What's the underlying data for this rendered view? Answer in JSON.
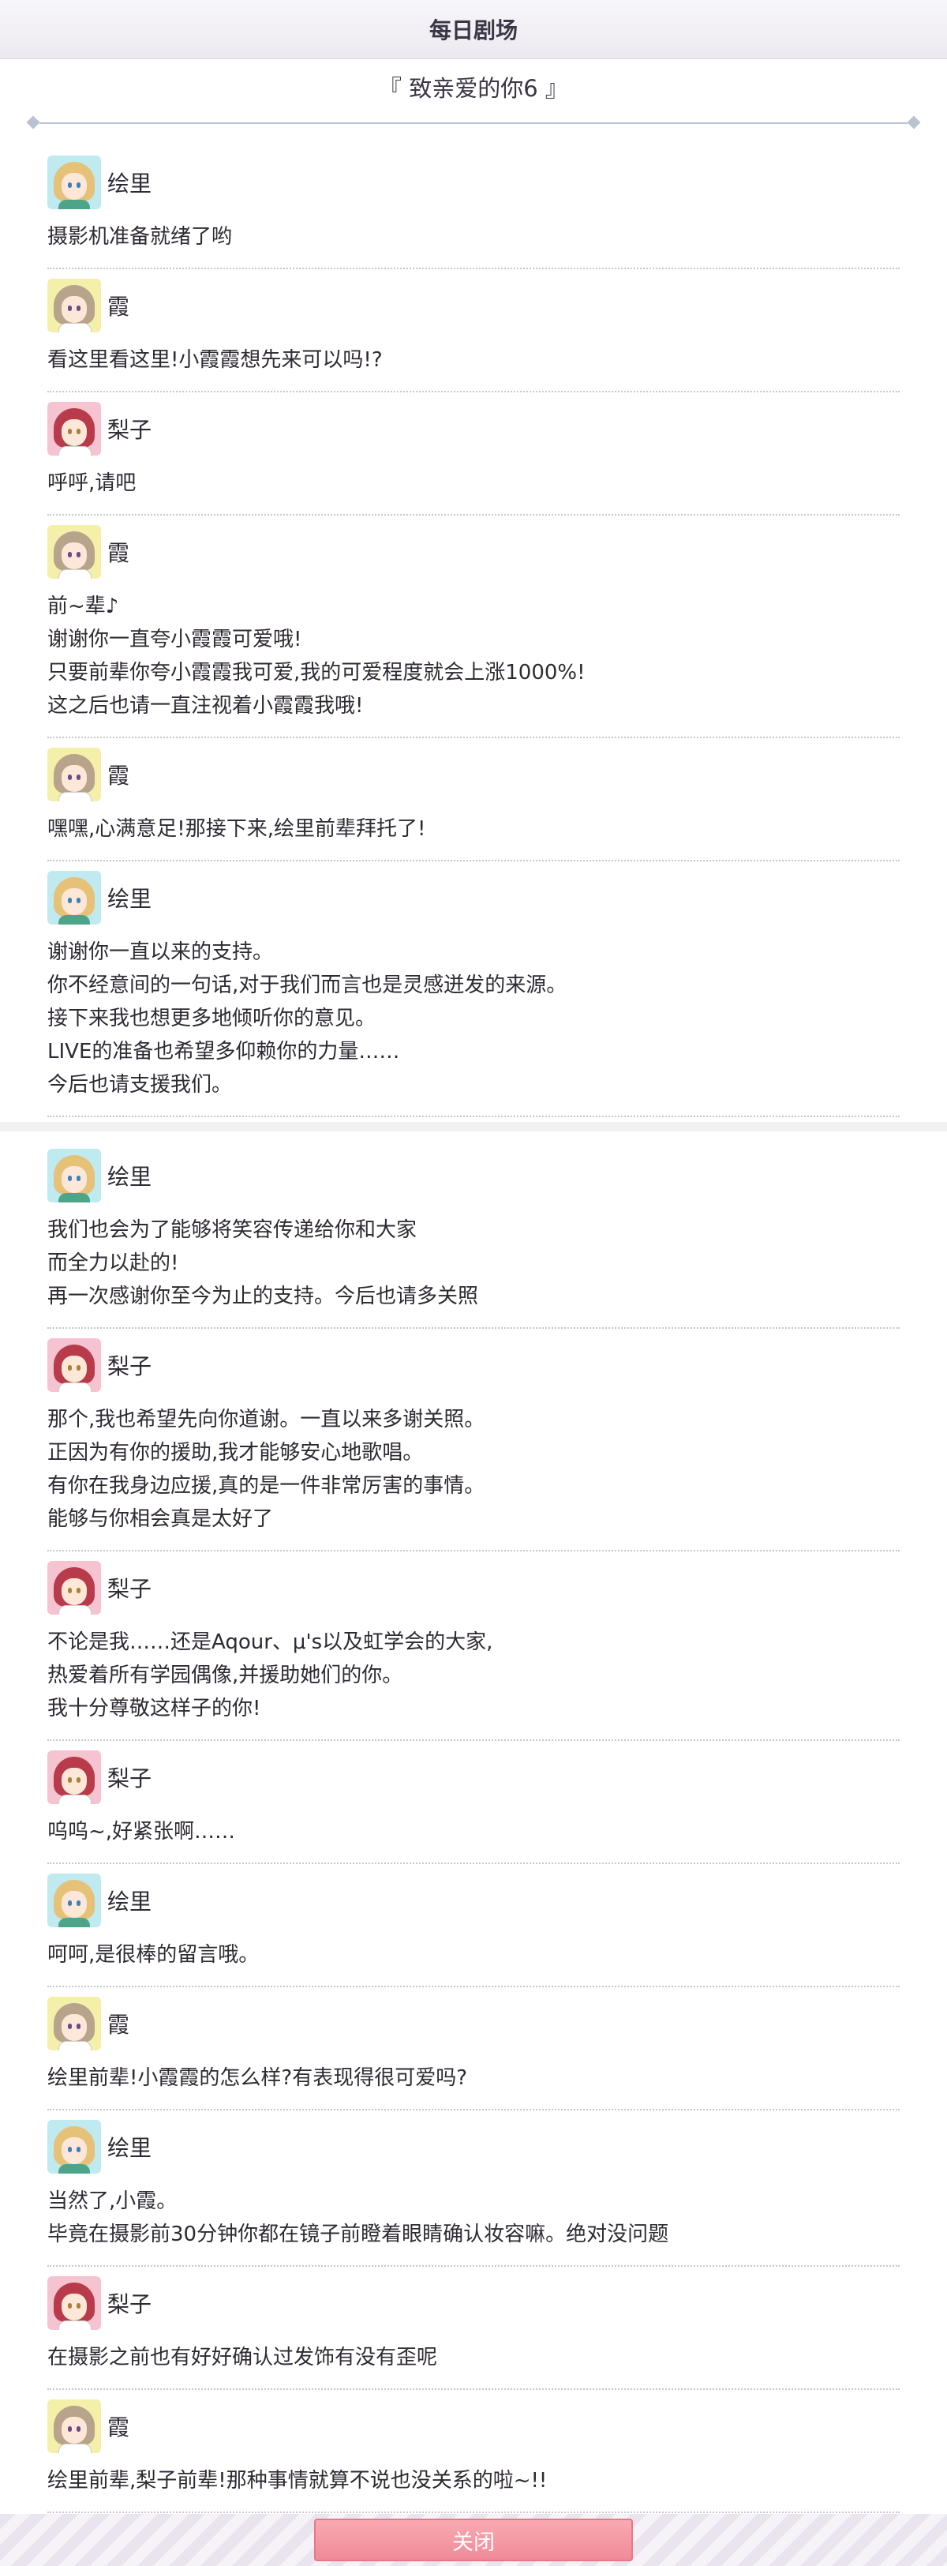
{
  "header": {
    "title": "每日剧场"
  },
  "episode": {
    "title": "『 致亲爱的你6 』"
  },
  "dialogue": [
    {
      "speaker": "绘里",
      "avatar": "eli",
      "lines": [
        "摄影机准备就绪了哟"
      ]
    },
    {
      "speaker": "霞",
      "avatar": "kasumi",
      "lines": [
        "看这里看这里!小霞霞想先来可以吗!?"
      ]
    },
    {
      "speaker": "梨子",
      "avatar": "riko",
      "lines": [
        "呼呼,请吧"
      ]
    },
    {
      "speaker": "霞",
      "avatar": "kasumi",
      "lines": [
        "前~辈♪",
        "谢谢你一直夸小霞霞可爱哦!",
        "只要前辈你夸小霞霞我可爱,我的可爱程度就会上涨1000%!",
        "这之后也请一直注视着小霞霞我哦!"
      ]
    },
    {
      "speaker": "霞",
      "avatar": "kasumi",
      "lines": [
        "嘿嘿,心满意足!那接下来,绘里前辈拜托了!"
      ]
    },
    {
      "speaker": "绘里",
      "avatar": "eli",
      "lines": [
        "谢谢你一直以来的支持。",
        "你不经意间的一句话,对于我们而言也是灵感迸发的来源。",
        "接下来我也想更多地倾听你的意见。",
        "LIVE的准备也希望多仰赖你的力量……",
        "今后也请支援我们。"
      ]
    },
    {
      "speaker": "绘里",
      "avatar": "eli",
      "lines": [
        "我们也会为了能够将笑容传递给你和大家",
        "而全力以赴的!",
        "再一次感谢你至今为止的支持。今后也请多关照"
      ]
    },
    {
      "speaker": "梨子",
      "avatar": "riko",
      "lines": [
        "那个,我也希望先向你道谢。一直以来多谢关照。",
        "正因为有你的援助,我才能够安心地歌唱。",
        "有你在我身边应援,真的是一件非常厉害的事情。",
        "能够与你相会真是太好了"
      ]
    },
    {
      "speaker": "梨子",
      "avatar": "riko",
      "lines": [
        "不论是我……还是Aqour、μ's以及虹学会的大家,",
        "热爱着所有学园偶像,并援助她们的你。",
        "我十分尊敬这样子的你!"
      ]
    },
    {
      "speaker": "梨子",
      "avatar": "riko",
      "lines": [
        "呜呜~,好紧张啊……"
      ]
    },
    {
      "speaker": "绘里",
      "avatar": "eli",
      "lines": [
        "呵呵,是很棒的留言哦。"
      ]
    },
    {
      "speaker": "霞",
      "avatar": "kasumi",
      "lines": [
        "绘里前辈!小霞霞的怎么样?有表现得很可爱吗?"
      ]
    },
    {
      "speaker": "绘里",
      "avatar": "eli",
      "lines": [
        "当然了,小霞。",
        "毕竟在摄影前30分钟你都在镜子前瞪着眼睛确认妆容嘛。绝对没问题"
      ]
    },
    {
      "speaker": "梨子",
      "avatar": "riko",
      "lines": [
        "在摄影之前也有好好确认过发饰有没有歪呢"
      ]
    },
    {
      "speaker": "霞",
      "avatar": "kasumi",
      "lines": [
        "绘里前辈,梨子前辈!那种事情就算不说也没关系的啦~!!"
      ]
    }
  ],
  "footer": {
    "close_label": "关闭"
  }
}
